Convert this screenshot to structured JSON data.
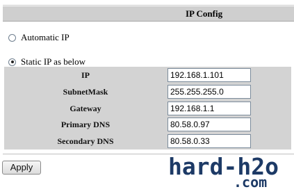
{
  "header": {
    "title": "IP Config"
  },
  "mode": {
    "automatic_label": "Automatic IP",
    "static_label": "Static IP as below",
    "selected": "static"
  },
  "fields": [
    {
      "label": "IP",
      "value": "192.168.1.101"
    },
    {
      "label": "SubnetMask",
      "value": "255.255.255.0"
    },
    {
      "label": "Gateway",
      "value": "192.168.1.1"
    },
    {
      "label": "Primary DNS",
      "value": "80.58.0.97"
    },
    {
      "label": "Secondary DNS",
      "value": "80.58.0.33"
    }
  ],
  "actions": {
    "apply_label": "Apply"
  },
  "watermark": {
    "line1": "hard-h2o",
    "line2": ".com"
  }
}
